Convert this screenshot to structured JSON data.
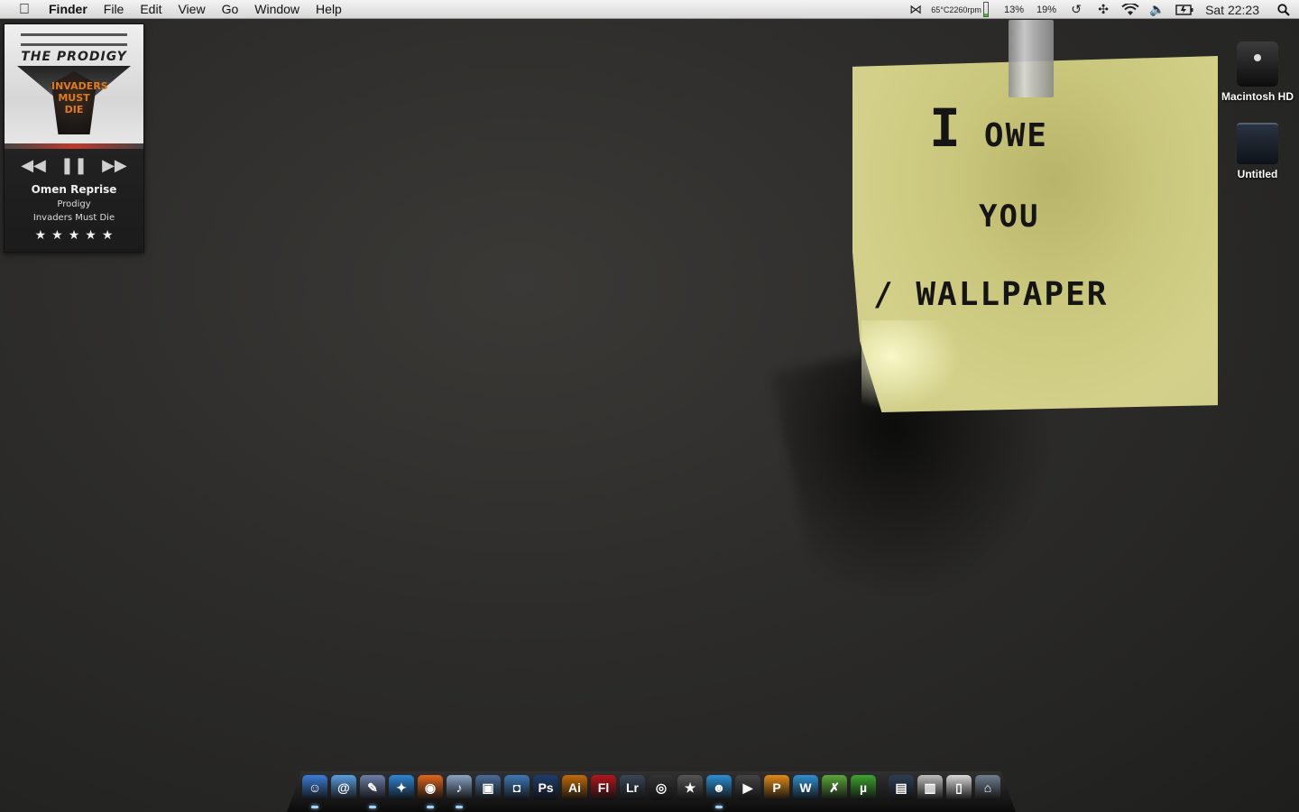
{
  "menubar": {
    "app_name": "Finder",
    "menus": [
      "File",
      "Edit",
      "View",
      "Go",
      "Window",
      "Help"
    ],
    "status": {
      "temperature": "65°C",
      "fan_speed": "2260rpm",
      "cpu_percent": "13%",
      "battery_percent": "19%",
      "battery_level": 0.19,
      "battery_color": "#3fbf2a",
      "clock": "Sat 22:23"
    }
  },
  "itunes_widget": {
    "album_art_logo": "THE PRODIGY",
    "album_art_title": "INVADERS MUST DIE",
    "track_title": "Omen Reprise",
    "artist": "Prodigy",
    "album": "Invaders Must Die",
    "rating": 5,
    "rating_stars": "★★★★★"
  },
  "sticky_note": {
    "line1_a": "I",
    "line1_b": "OWE",
    "line2": "YOU",
    "line3": "/ WALLPAPER"
  },
  "desktop_icons": [
    {
      "label": "Macintosh HD"
    },
    {
      "label": "Untitled"
    }
  ],
  "dock": {
    "items": [
      {
        "name": "finder",
        "glyph": "☺",
        "color": "#3b7dd8",
        "running": true
      },
      {
        "name": "mail",
        "glyph": "@",
        "color": "#5a9fe0",
        "running": false
      },
      {
        "name": "preview",
        "glyph": "✎",
        "color": "#6d7fa8",
        "running": true
      },
      {
        "name": "safari",
        "glyph": "✦",
        "color": "#2f86d6",
        "running": false
      },
      {
        "name": "firefox",
        "glyph": "◉",
        "color": "#e0661c",
        "running": true
      },
      {
        "name": "itunes",
        "glyph": "♪",
        "color": "#8aa4c4",
        "running": true
      },
      {
        "name": "iphoto",
        "glyph": "▣",
        "color": "#4a6c9a",
        "running": false
      },
      {
        "name": "image-capture",
        "glyph": "◘",
        "color": "#3d78b8",
        "running": false
      },
      {
        "name": "photoshop",
        "glyph": "Ps",
        "color": "#1c3d6e",
        "running": false
      },
      {
        "name": "illustrator",
        "glyph": "Ai",
        "color": "#c46a08",
        "running": false
      },
      {
        "name": "flash",
        "glyph": "Fl",
        "color": "#b3161b",
        "running": false
      },
      {
        "name": "lightroom",
        "glyph": "Lr",
        "color": "#3a4656",
        "running": false
      },
      {
        "name": "aperture",
        "glyph": "◎",
        "color": "#333333",
        "running": false
      },
      {
        "name": "imovie",
        "glyph": "★",
        "color": "#555555",
        "running": false
      },
      {
        "name": "messenger",
        "glyph": "☻",
        "color": "#2a8fd4",
        "running": true
      },
      {
        "name": "facetime",
        "glyph": "▶",
        "color": "#444444",
        "running": false
      },
      {
        "name": "app-p",
        "glyph": "P",
        "color": "#e28a16",
        "running": false
      },
      {
        "name": "app-w",
        "glyph": "W",
        "color": "#2f8fd0",
        "running": false
      },
      {
        "name": "app-x",
        "glyph": "✗",
        "color": "#5ba83a",
        "running": false
      },
      {
        "name": "utorrent",
        "glyph": "µ",
        "color": "#3da52e",
        "running": false
      },
      {
        "name": "downloads-stack",
        "glyph": "▤",
        "color": "#2c3e56",
        "running": false
      },
      {
        "name": "documents-stack",
        "glyph": "▥",
        "color": "#bdbdbd",
        "running": false
      },
      {
        "name": "applications-stack",
        "glyph": "▯",
        "color": "#d8d8d8",
        "running": false
      },
      {
        "name": "trash",
        "glyph": "⌂",
        "color": "#6f7f8f",
        "running": false
      }
    ]
  }
}
